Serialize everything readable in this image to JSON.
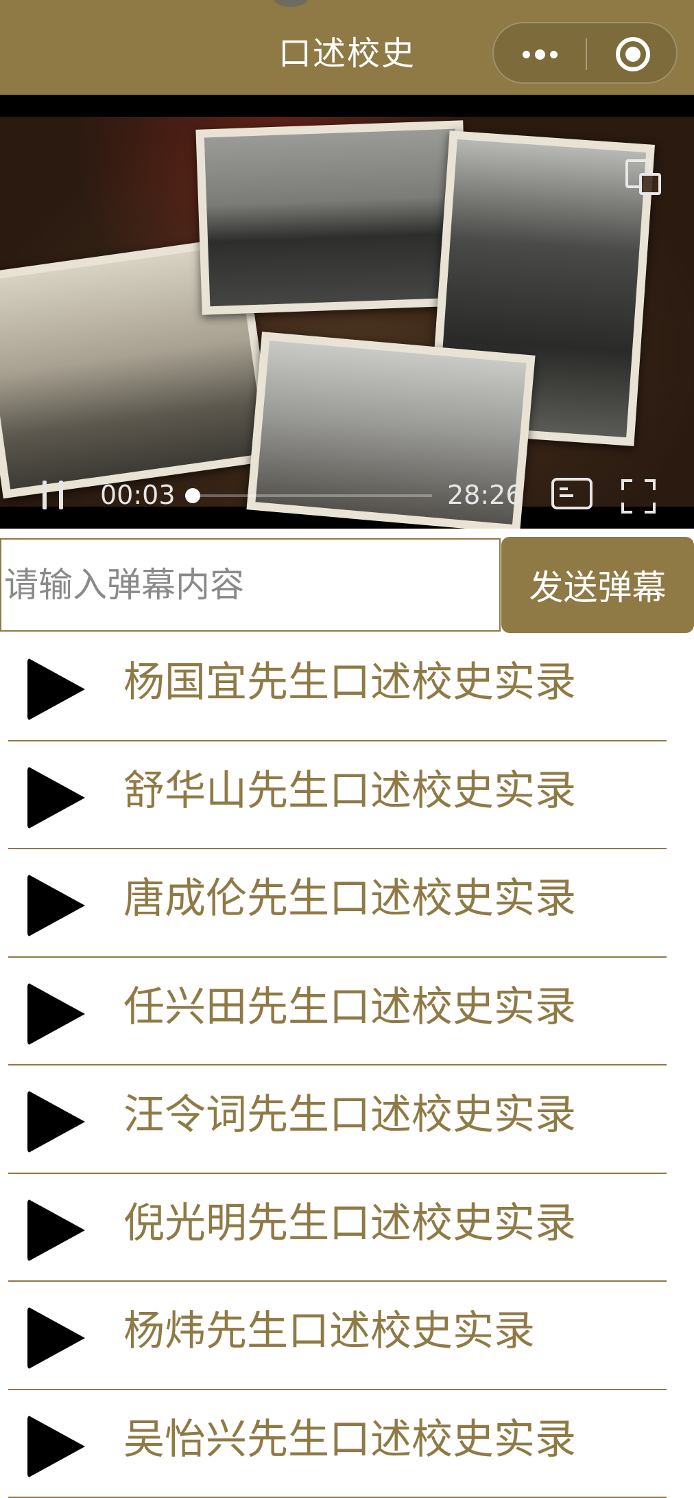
{
  "header": {
    "title": "口述校史",
    "background_color": "#8f7a45",
    "more_icon": "more-dots-icon",
    "close_icon": "miniprogram-close-icon"
  },
  "video": {
    "current_time": "00:03",
    "total_time": "28:26",
    "progress_fraction": 0.002,
    "icons": [
      "pause-icon",
      "cast-icon",
      "danmu-toggle-icon",
      "fullscreen-icon"
    ]
  },
  "danmu": {
    "placeholder": "请输入弹幕内容",
    "send_label": "发送弹幕"
  },
  "list": {
    "accent_color": "#8f7a45",
    "items": [
      {
        "title": "杨国宜先生口述校史实录"
      },
      {
        "title": "舒华山先生口述校史实录"
      },
      {
        "title": "唐成伦先生口述校史实录"
      },
      {
        "title": "任兴田先生口述校史实录"
      },
      {
        "title": "汪令词先生口述校史实录"
      },
      {
        "title": "倪光明先生口述校史实录"
      },
      {
        "title": "杨炜先生口述校史实录"
      },
      {
        "title": "吴怡兴先生口述校史实录"
      }
    ]
  }
}
